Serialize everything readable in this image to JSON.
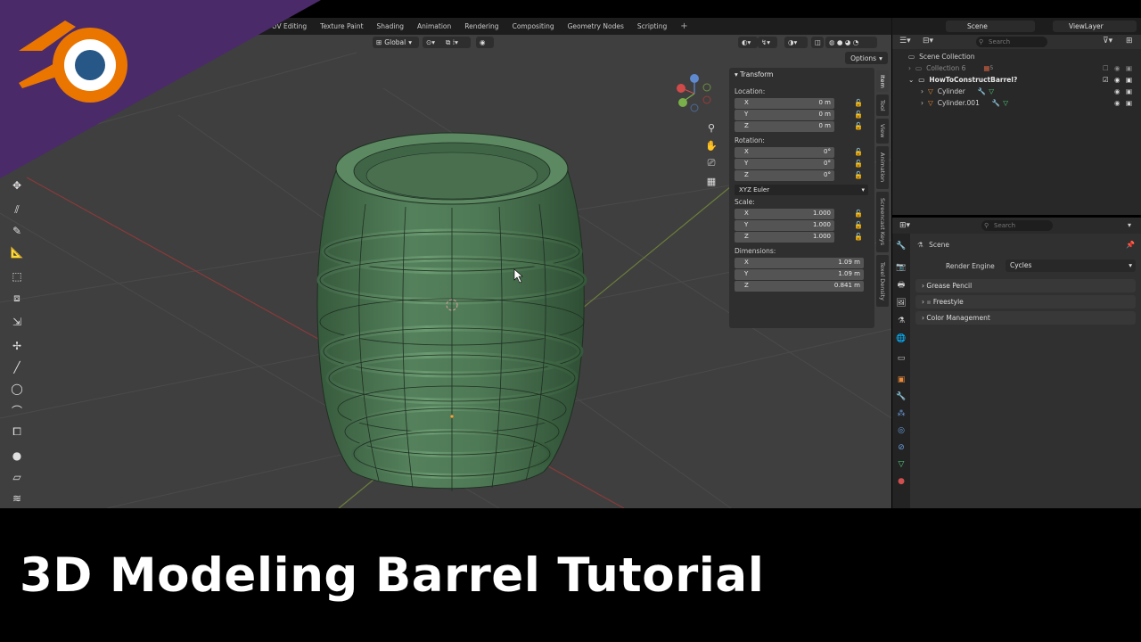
{
  "workspace": {
    "tabs": [
      "UV Editing",
      "Texture Paint",
      "Shading",
      "Animation",
      "Rendering",
      "Compositing",
      "Geometry Nodes",
      "Scripting"
    ],
    "add_tab": "+",
    "scene_name": "Scene",
    "view_layer": "ViewLayer"
  },
  "viewport_header": {
    "orientation": "Global",
    "options_label": "Options"
  },
  "transform_panel": {
    "title": "Transform",
    "location_label": "Location:",
    "location": [
      {
        "axis": "X",
        "value": "0 m"
      },
      {
        "axis": "Y",
        "value": "0 m"
      },
      {
        "axis": "Z",
        "value": "0 m"
      }
    ],
    "rotation_label": "Rotation:",
    "rotation": [
      {
        "axis": "X",
        "value": "0°"
      },
      {
        "axis": "Y",
        "value": "0°"
      },
      {
        "axis": "Z",
        "value": "0°"
      }
    ],
    "rotation_mode": "XYZ Euler",
    "scale_label": "Scale:",
    "scale": [
      {
        "axis": "X",
        "value": "1.000"
      },
      {
        "axis": "Y",
        "value": "1.000"
      },
      {
        "axis": "Z",
        "value": "1.000"
      }
    ],
    "dimensions_label": "Dimensions:",
    "dimensions": [
      {
        "axis": "X",
        "value": "1.09 m"
      },
      {
        "axis": "Y",
        "value": "1.09 m"
      },
      {
        "axis": "Z",
        "value": "0.841 m"
      }
    ]
  },
  "sidebar_tabs": [
    "Item",
    "Tool",
    "View",
    "Animation",
    "Screencast Keys",
    "Texel Density"
  ],
  "outliner": {
    "search_placeholder": "Search",
    "root": "Scene Collection",
    "items": [
      {
        "label": "Collection 6",
        "count": "5"
      },
      {
        "label": "HowToConstructBarrel?"
      },
      {
        "label": "Cylinder"
      },
      {
        "label": "Cylinder.001"
      }
    ]
  },
  "properties": {
    "search_placeholder": "Search",
    "context": "Scene",
    "render_engine_label": "Render Engine",
    "render_engine_value": "Cycles",
    "panels": [
      "Grease Pencil",
      "Freestyle",
      "Color Management"
    ]
  },
  "caption": "3D Modeling Barrel Tutorial",
  "colors": {
    "brand_purple": "#4b2a6a",
    "blender_orange": "#ea7600",
    "blender_blue": "#265787",
    "barrel_green": "#4f7a56",
    "viewport_bg": "#3f3f3f"
  }
}
